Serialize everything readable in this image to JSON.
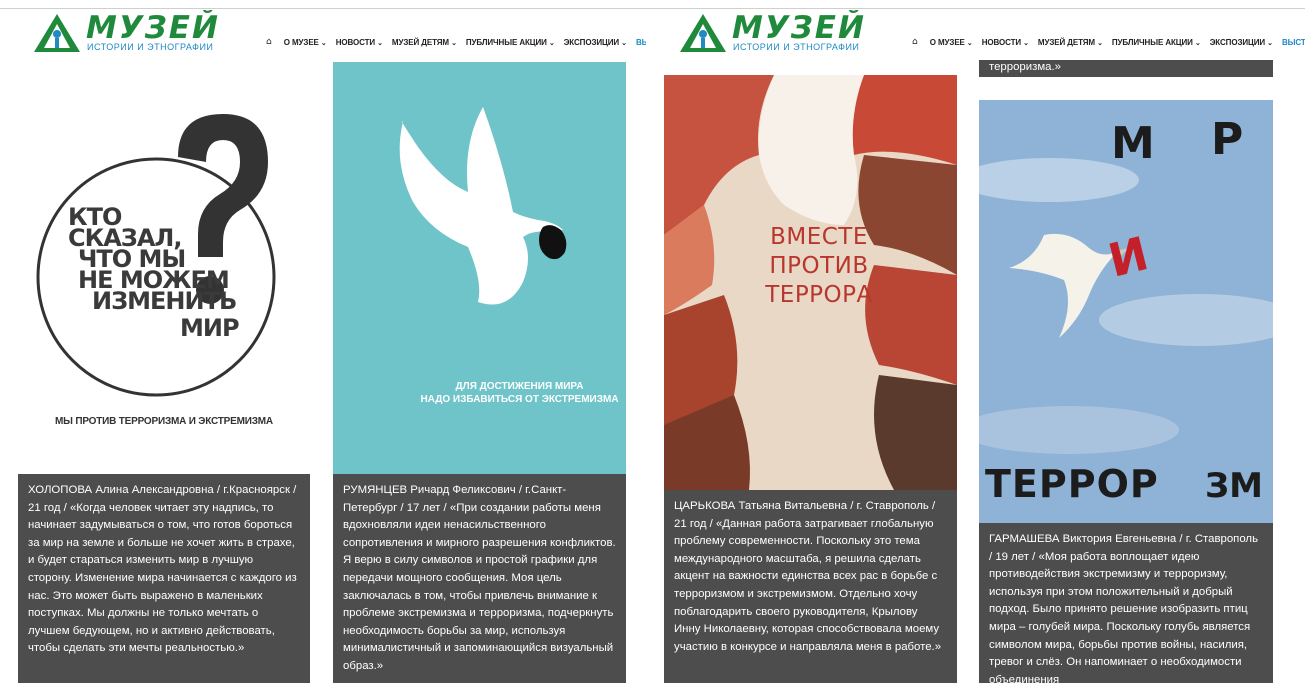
{
  "site": {
    "logo_word": "МУЗЕЙ",
    "logo_subtitle": "ИСТОРИИ И ЭТНОГРАФИИ",
    "nav": [
      {
        "label": "О МУЗЕЕ"
      },
      {
        "label": "НОВОСТИ"
      },
      {
        "label": "МУЗЕЙ ДЕТЯМ"
      },
      {
        "label": "ПУБЛИЧНЫЕ АКЦИИ"
      },
      {
        "label": "ЭКСПОЗИЦИИ"
      }
    ],
    "nav_active_left": "ВЫСТАІ",
    "nav_active_right": "ВЫСТАВКИ",
    "accent_color": "#1e88c7",
    "brand_green": "#1f8a3b"
  },
  "cards": [
    {
      "poster_lines": [
        "КТО",
        "СКАЗАЛ,",
        "ЧТО МЫ",
        "НЕ МОЖЕМ",
        "ИЗМЕНИТЬ",
        "МИР"
      ],
      "poster_tagline": "МЫ ПРОТИВ ТЕРРОРИЗМА И ЭКСТРЕМИЗМА",
      "caption": "ХОЛОПОВА Алина Александровна / г.Красноярск / 21 год / «Когда человек читает эту надпись, то начинает задумываться о том, что готов бороться за мир на земле и больше не хочет жить в страхе, и будет стараться изменить мир в лучшую сторону. Изменение мира начинается с каждого из нас. Это может быть выражено в маленьких поступках. Мы должны не только мечтать о лучшем бедующем, но и активно действовать, чтобы сделать эти мечты реальностью.»"
    },
    {
      "poster_slogan_line1": "ДЛЯ ДОСТИЖЕНИЯ МИРА",
      "poster_slogan_line2": "НАДО ИЗБАВИТЬСЯ ОТ ЭКСТРЕМИЗМА",
      "caption": "РУМЯНЦЕВ Ричард Феликсович / г.Санкт-Петербург / 17 лет / «При создании работы меня вдохновляли идеи ненасильственного сопротивления и мирного разрешения конфликтов. Я верю в силу символов и простой графики для передачи мощного сообщения. Моя цель заключалась в том, чтобы привлечь внимание к проблеме экстремизма и терроризма, подчеркнуть необходимость борьбы за мир, используя минималистичный и запоминающийся визуальный образ.»"
    },
    {
      "poster_title_lines": [
        "ВМЕСТЕ",
        "ПРОТИВ",
        "ТЕРРОРА"
      ],
      "caption": "ЦАРЬКОВА Татьяна Витальевна / г. Ставрополь / 21 год / «Данная работа затрагивает глобальную проблему современности. Поскольку это тема международного масштаба, я решила сделать акцент на важности единства всех рас в борьбе с терроризмом и экстремизмом. Отдельно хочу поблагодарить своего руководителя, Крылову Инну Николаевну, которая способствовала моему участию в конкурсе и направляла меня в работе.»"
    },
    {
      "top_caption_fragment": "терроризма.»",
      "poster_top_letters": [
        "М",
        "Р"
      ],
      "poster_middle_letter": "И",
      "poster_bottom_left": "ТЕРРОР",
      "poster_bottom_right": "ЗМ",
      "caption": "ГАРМАШЕВА Виктория Евгеньевна / г. Ставрополь / 19 лет / «Моя работа воплощает идею противодействия экстремизму и терроризму, используя при этом положительный и добрый подход. Было принято решение изобразить птиц мира – голубей мира. Поскольку голубь является символом мира, борьбы против войны, насилия, тревог и слёз. Он напоминает о необходимости объединения"
    }
  ]
}
